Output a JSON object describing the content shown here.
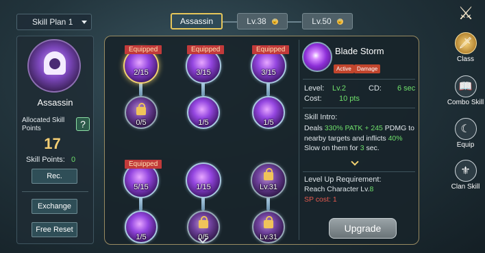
{
  "skill_plan": {
    "label": "Skill Plan 1",
    "caret": "chevron-down-icon"
  },
  "tabs": [
    {
      "label": "Assassin",
      "locked": false,
      "selected": true
    },
    {
      "label": "Lv.38",
      "locked": true
    },
    {
      "label": "Lv.50",
      "locked": true
    }
  ],
  "class_panel": {
    "class_name": "Assassin",
    "allocated_label": "Allocated Skill Points",
    "allocated_value": "17",
    "help_label": "?",
    "sp_label": "Skill Points:",
    "sp_value": "0",
    "rec_label": "Rec.",
    "exchange_label": "Exchange",
    "reset_label": "Free Reset"
  },
  "tree": {
    "nodes": [
      {
        "count": "2/15",
        "equipped": "Equipped",
        "selected": true
      },
      {
        "count": "3/15",
        "equipped": "Equipped"
      },
      {
        "count": "3/15",
        "equipped": "Equipped"
      },
      {
        "count": "0/5",
        "locked": true
      },
      {
        "count": "1/5"
      },
      {
        "count": "1/5"
      },
      {
        "count": "5/15",
        "equipped": "Equipped"
      },
      {
        "count": "1/15"
      },
      {
        "count": "Lv.31",
        "locked": true
      },
      {
        "count": "1/5"
      },
      {
        "count": "0/5",
        "locked": true
      },
      {
        "count": "Lv.31",
        "locked": true
      }
    ]
  },
  "detail": {
    "name": "Blade Storm",
    "badges": [
      "Active",
      "Damage"
    ],
    "level_label": "Level:",
    "level_value": "Lv.2",
    "cd_label": "CD:",
    "cd_value": "6 sec",
    "cost_label": "Cost:",
    "cost_value": "10 pts",
    "intro_label": "Skill Intro:",
    "intro_p1": "Deals ",
    "intro_v1": "330% PATK + 245",
    "intro_p2": " PDMG to nearby targets and inflicts ",
    "intro_v2": "40%",
    "intro_p3": " Slow on them for ",
    "intro_v3": "3",
    "intro_p4": " sec.",
    "req_title": "Level Up Requirement:",
    "req_char_prefix": "Reach Character Lv.",
    "req_char_value": "8",
    "req_sp_label": "SP cost: ",
    "req_sp_value": "1",
    "upgrade_label": "Upgrade"
  },
  "nav": [
    {
      "label": "",
      "icon": "crossed-swords-icon"
    },
    {
      "label": "Class",
      "icon": "sword-icon",
      "active": true
    },
    {
      "label": "Combo Skill",
      "icon": "book-icon"
    },
    {
      "label": "Equip",
      "icon": "crescent-icon"
    },
    {
      "label": "Clan Skill",
      "icon": "crest-icon"
    }
  ],
  "colors": {
    "gold": "#f2d271",
    "green": "#6fe06b",
    "red": "#c23a3a",
    "purple": "#9446e0"
  }
}
